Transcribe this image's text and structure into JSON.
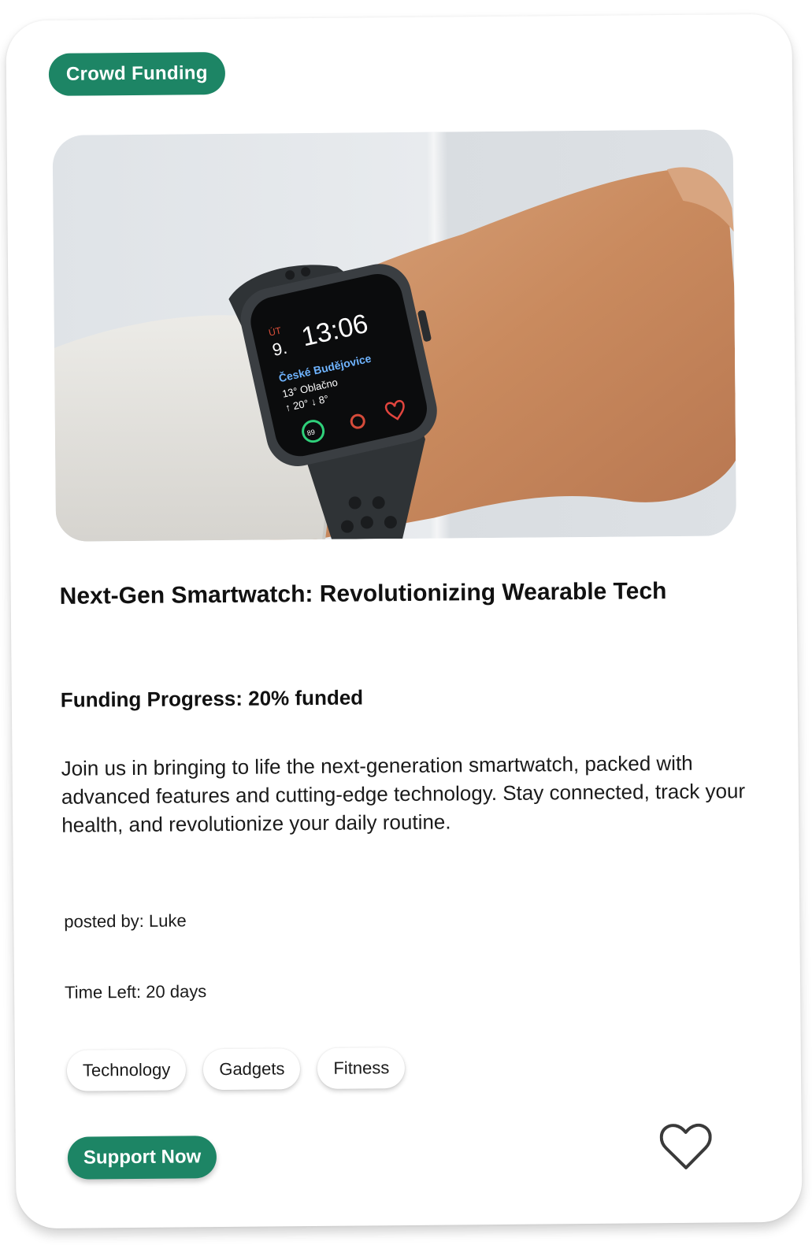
{
  "card": {
    "category_label": "Crowd Funding",
    "image_icon": "smartwatch-photo",
    "title": "Next-Gen Smartwatch: Revolutionizing Wearable Tech",
    "funding_progress": "Funding Progress: 20% funded",
    "description": "Join us in bringing to life the next-generation smartwatch, packed with advanced features and cutting-edge technology. Stay connected, track your health, and revolutionize your daily routine.",
    "posted_by": "posted by: Luke",
    "time_left": "Time Left: 20 days",
    "tags": [
      "Technology",
      "Gadgets",
      "Fitness"
    ],
    "support_label": "Support Now",
    "favorite_icon": "heart-icon"
  },
  "watch_face": {
    "day_abbr": "ÚT",
    "day_num": "9.",
    "time": "13:06",
    "city": "České Budějovice",
    "weather": "13° Oblačno",
    "temps": "↑ 20° ↓ 8°",
    "ring_value": "89"
  },
  "colors": {
    "accent": "#1d8565",
    "text": "#111111"
  }
}
